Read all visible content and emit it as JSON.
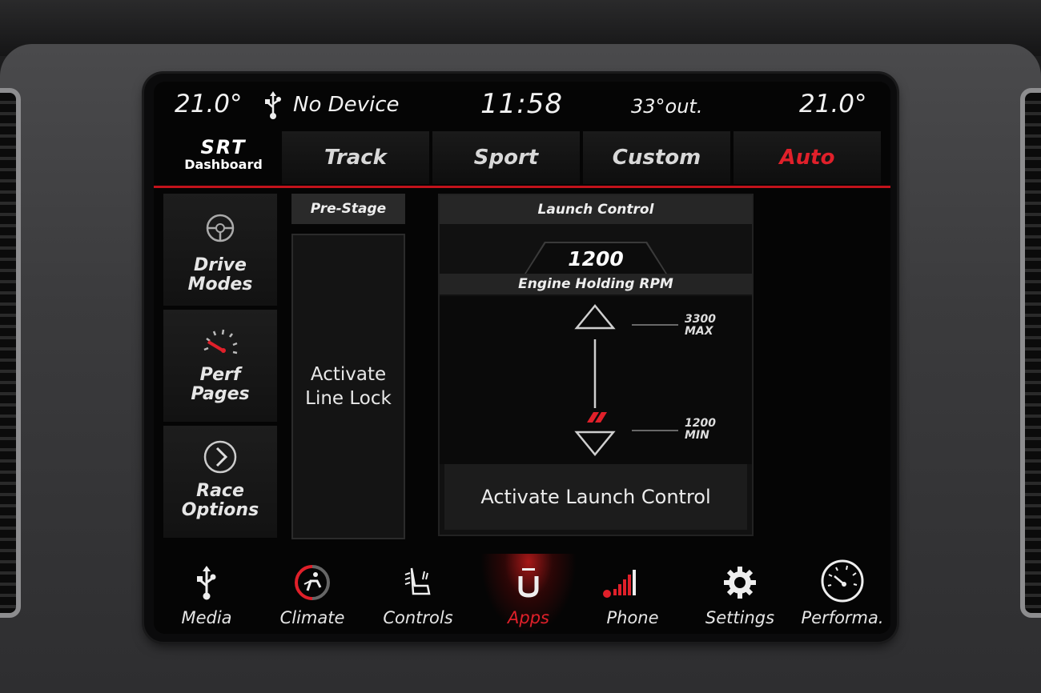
{
  "status": {
    "temp_left": "21.0°",
    "usb_icon": "usb-icon",
    "device": "No Device",
    "time": "11:58",
    "outside": "33°out.",
    "temp_right": "21.0°"
  },
  "brand": {
    "logo": "SRT",
    "subtitle": "Dashboard"
  },
  "modes": [
    {
      "label": "Track"
    },
    {
      "label": "Sport"
    },
    {
      "label": "Custom"
    },
    {
      "label": "Auto",
      "active": true
    }
  ],
  "sidebar": [
    {
      "line1": "Drive",
      "line2": "Modes",
      "icon": "steering-wheel-icon"
    },
    {
      "line1": "Perf",
      "line2": "Pages",
      "icon": "gauge-icon"
    },
    {
      "line1": "Race",
      "line2": "Options",
      "icon": "chevron-right-icon"
    }
  ],
  "prestage": {
    "header": "Pre-Stage",
    "line1": "Activate",
    "line2": "Line Lock"
  },
  "launch_control": {
    "title": "Launch Control",
    "rpm": "1200",
    "rpm_label": "Engine Holding RPM",
    "max_value": "3300",
    "max_label": "MAX",
    "min_value": "1200",
    "min_label": "MIN",
    "activate_label": "Activate Launch Control"
  },
  "bottom_nav": [
    {
      "label": "Media",
      "icon": "usb-icon"
    },
    {
      "label": "Climate",
      "icon": "climate-seat-icon"
    },
    {
      "label": "Controls",
      "icon": "seat-controls-icon"
    },
    {
      "label": "Apps",
      "icon": "apps-icon",
      "active": true
    },
    {
      "label": "Phone",
      "icon": "phone-signal-icon"
    },
    {
      "label": "Settings",
      "icon": "gear-icon"
    },
    {
      "label": "Performa.",
      "icon": "speedometer-icon"
    }
  ],
  "colors": {
    "accent_red": "#e0202a",
    "background": "#050505"
  }
}
